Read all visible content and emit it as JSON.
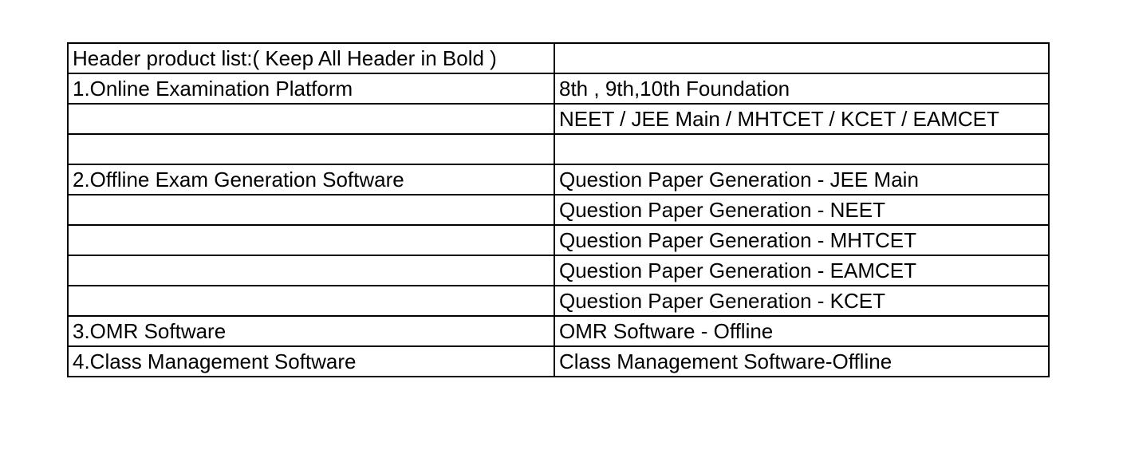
{
  "table": {
    "rows": [
      {
        "left": "Header product list:( Keep All Header in Bold )",
        "right": ""
      },
      {
        "left": "1.Online Examination Platform",
        "right": "8th , 9th,10th Foundation"
      },
      {
        "left": "",
        "right": "NEET / JEE Main /  MHTCET / KCET / EAMCET"
      },
      {
        "left": "",
        "right": ""
      },
      {
        "left": "2.Offline Exam Generation Software",
        "right": "Question Paper Generation - JEE Main"
      },
      {
        "left": "",
        "right": "Question Paper Generation - NEET"
      },
      {
        "left": "",
        "right": "Question Paper Generation - MHTCET"
      },
      {
        "left": "",
        "right": "Question Paper Generation - EAMCET"
      },
      {
        "left": "",
        "right": "Question Paper Generation - KCET"
      },
      {
        "left": "3.OMR Software",
        "right": "OMR Software - Offline"
      },
      {
        "left": "4.Class Management Software",
        "right": "Class Management Software-Offline"
      }
    ]
  }
}
